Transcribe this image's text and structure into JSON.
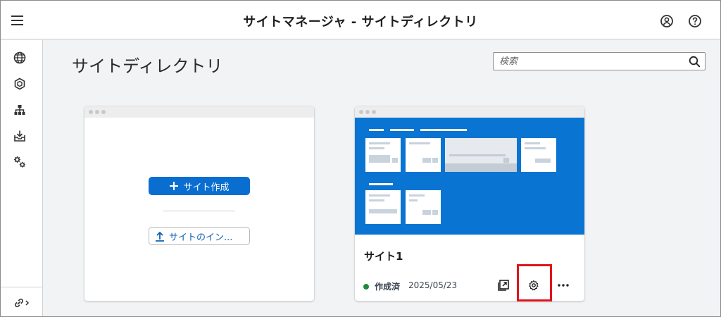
{
  "header": {
    "title": "サイトマネージャ - サイトディレクトリ"
  },
  "rail": {
    "items": [
      "globe-icon",
      "cube-icon",
      "hierarchy-icon",
      "inbox-download-icon",
      "settings-gears-icon"
    ],
    "footer": "link-expand-icon"
  },
  "main": {
    "page_title": "サイトディレクトリ",
    "search": {
      "placeholder": "検索"
    }
  },
  "create_card": {
    "create_label": "サイト作成",
    "import_label": "サイトのイン..."
  },
  "site_card": {
    "name": "サイト1",
    "status": "作成済",
    "date": "2025/05/23",
    "status_color": "#1f8a3c"
  },
  "colors": {
    "accent": "#0a6ed1",
    "highlight": "#e0141c"
  }
}
